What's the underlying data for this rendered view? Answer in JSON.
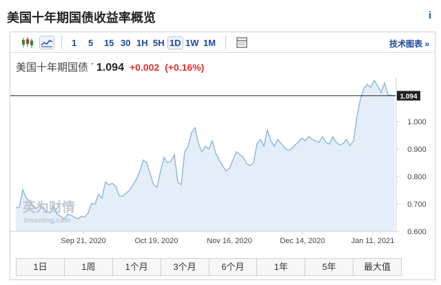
{
  "page": {
    "title": "美国十年期国债收益率概览",
    "info_label": "i"
  },
  "toolbar": {
    "intervals": [
      "1",
      "5",
      "15",
      "30",
      "1H",
      "5H",
      "1D",
      "1W",
      "1M"
    ],
    "active_interval": "1D",
    "tech_label": "技术图表 »"
  },
  "quote": {
    "name": "美国十年期国债",
    "star": "*",
    "price": "1.094",
    "change": "+0.002",
    "change_pct": "(+0.16%)"
  },
  "watermark": {
    "brand": "英为财情",
    "sub": "Investing.com"
  },
  "ranges": [
    "1日",
    "1周",
    "1个月",
    "3个月",
    "6个月",
    "1年",
    "5年",
    "最大值"
  ],
  "colors": {
    "line": "#8ab6dc",
    "fill": "#e3eef8",
    "current_line": "#222222",
    "price_tag": "#222222",
    "up": "#e0322e",
    "accent": "#1a4a9c"
  },
  "chart_data": {
    "type": "area",
    "series": [
      {
        "values": [
          0.686,
          0.688,
          0.752,
          0.722,
          0.712,
          0.692,
          0.684,
          0.695,
          0.682,
          0.672,
          0.668,
          0.692,
          0.662,
          0.655,
          0.645,
          0.662,
          0.66,
          0.652,
          0.646,
          0.655,
          0.652,
          0.668,
          0.702,
          0.7,
          0.735,
          0.722,
          0.78,
          0.77,
          0.775,
          0.765,
          0.73,
          0.728,
          0.74,
          0.75,
          0.77,
          0.79,
          0.82,
          0.86,
          0.85,
          0.81,
          0.77,
          0.76,
          0.82,
          0.87,
          0.85,
          0.855,
          0.88,
          0.78,
          0.77,
          0.89,
          0.91,
          0.96,
          0.978,
          0.92,
          0.89,
          0.91,
          0.9,
          0.93,
          0.885,
          0.86,
          0.84,
          0.82,
          0.83,
          0.86,
          0.89,
          0.88,
          0.87,
          0.846,
          0.84,
          0.85,
          0.92,
          0.935,
          0.91,
          0.97,
          0.93,
          0.91,
          0.935,
          0.92,
          0.905,
          0.895,
          0.9,
          0.915,
          0.925,
          0.94,
          0.93,
          0.945,
          0.935,
          0.93,
          0.925,
          0.945,
          0.925,
          0.918,
          0.945,
          0.925,
          0.915,
          0.92,
          0.935,
          0.912,
          0.93,
          1.02,
          1.08,
          1.12,
          1.135,
          1.125,
          1.15,
          1.13,
          1.105,
          1.14,
          1.098,
          1.095,
          1.094
        ]
      }
    ],
    "x_ticks": [
      "Sep 21, 2020",
      "Oct 19, 2020",
      "Nov 16, 2020",
      "Dec 14, 2020",
      "Jan 11, 2021"
    ],
    "y_ticks": [
      "0.600",
      "0.700",
      "0.800",
      "0.900",
      "1.000"
    ],
    "ylim": [
      0.6,
      1.15
    ],
    "current_value": 1.094,
    "current_label": "1.094",
    "grid": false
  }
}
